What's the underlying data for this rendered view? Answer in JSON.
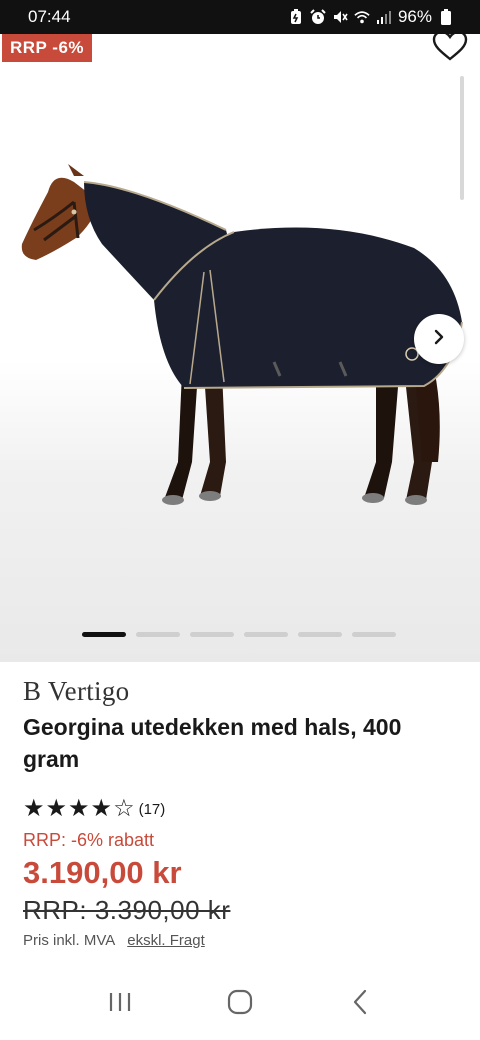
{
  "status": {
    "time": "07:44",
    "battery": "96%",
    "icons": [
      "battery-saver-icon",
      "alarm-icon",
      "mute-icon",
      "wifi-icon",
      "signal-icon",
      "battery-icon"
    ]
  },
  "hero": {
    "badge": "RRP -6%",
    "wishlist_icon": "heart-icon",
    "next_icon": "chevron-right-icon",
    "slide_count": 6,
    "active_slide": 1
  },
  "product": {
    "brand": "B Vertigo",
    "title": "Georgina utedekken med hals, 400 gram",
    "rating": {
      "stars": 4,
      "max_stars": 5,
      "count_label": "(17)"
    },
    "discount_text": "RRP: -6% rabatt",
    "price": "3.190,00 kr",
    "old_price": "RRP: 3.390,00 kr",
    "price_note": "Pris inkl. MVA",
    "shipping_link": "ekskl. Fragt"
  },
  "colors": {
    "accent": "#c84a3a",
    "text": "#1a1a1a",
    "status_bg": "#111111"
  },
  "navigation": [
    "recent-apps-icon",
    "home-icon",
    "back-icon"
  ]
}
